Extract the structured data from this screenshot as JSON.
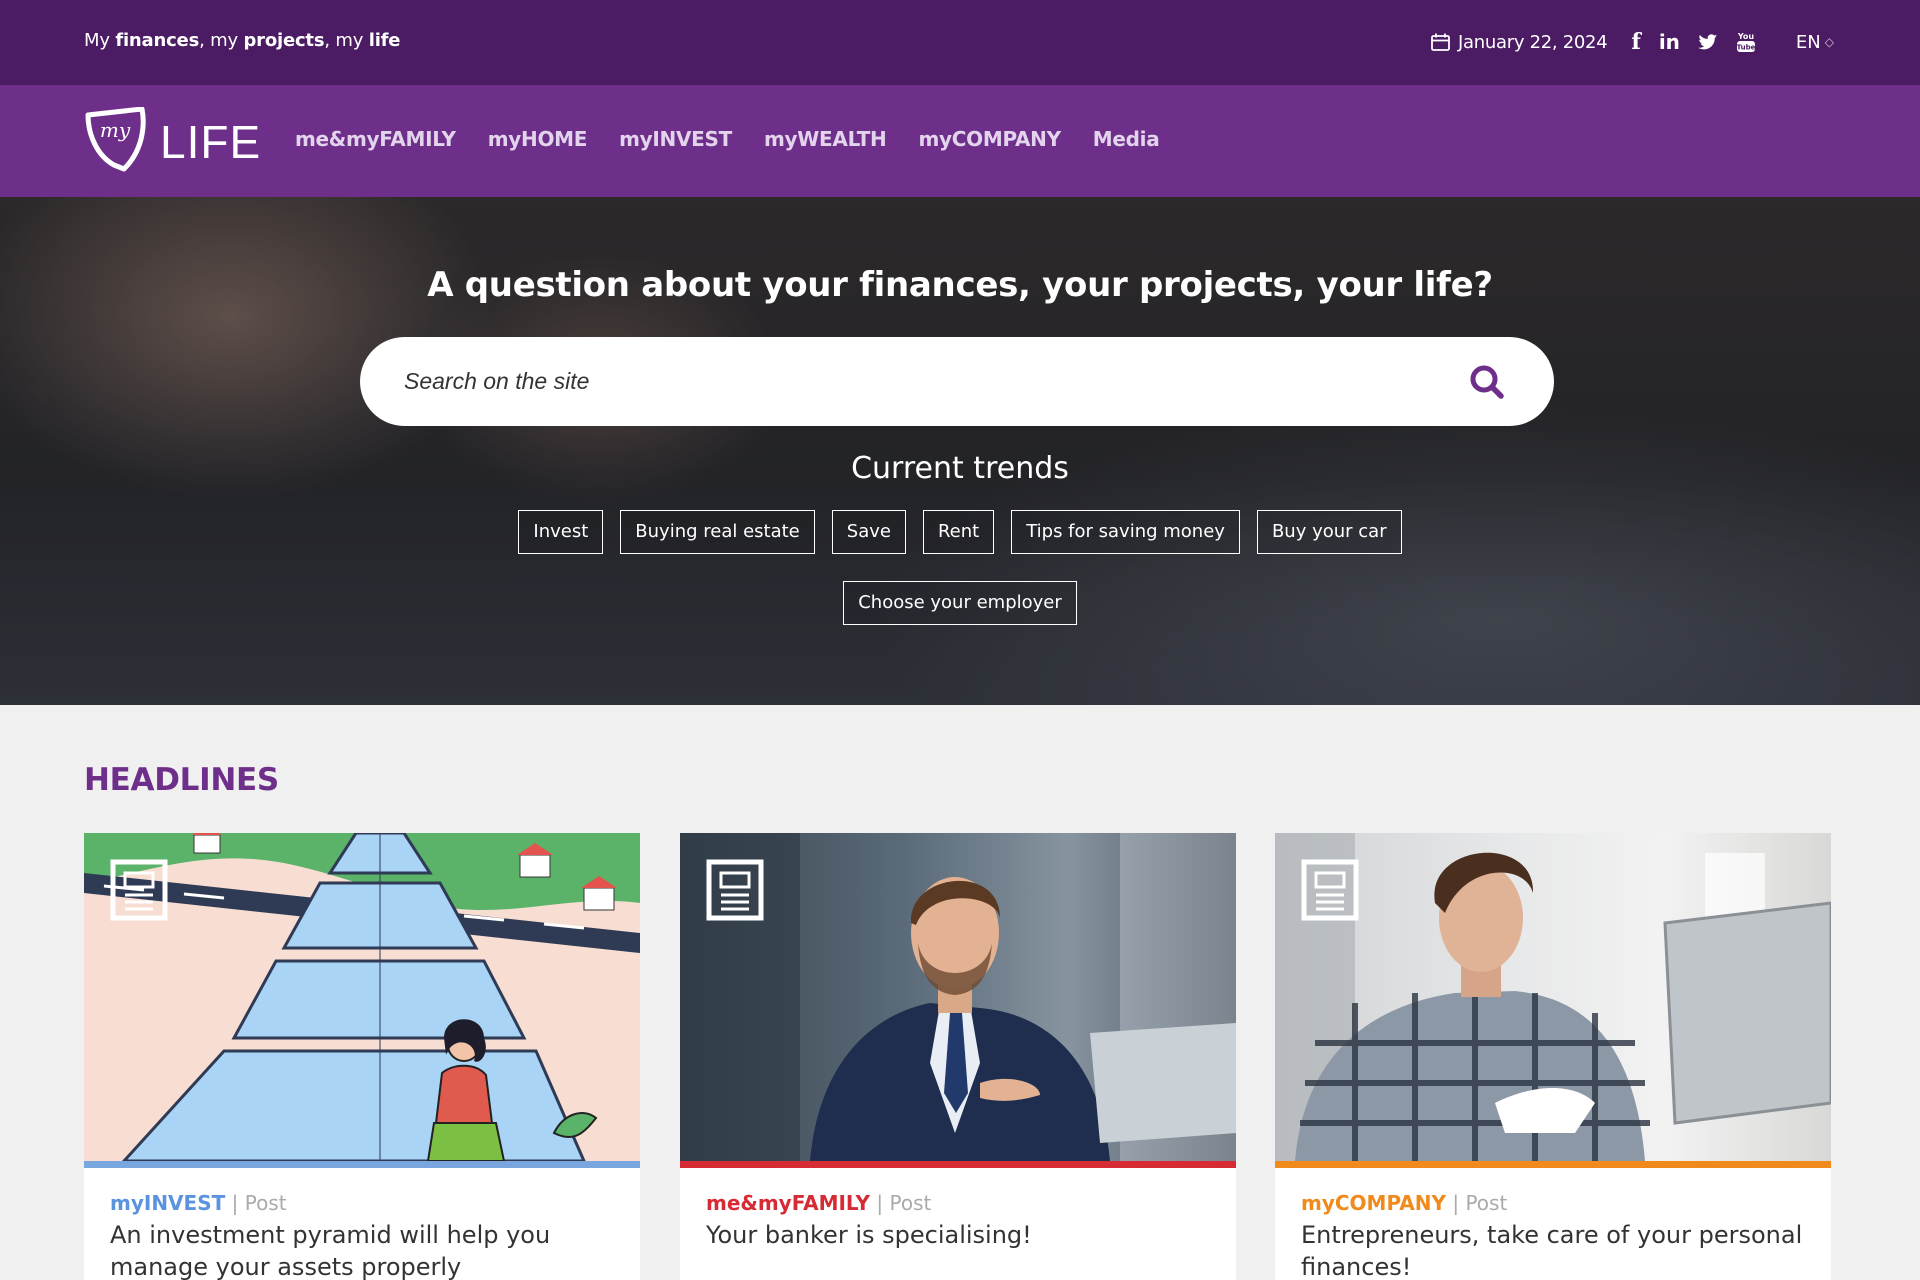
{
  "topbar": {
    "tagline": {
      "t1": "My ",
      "b1": "finances",
      "t2": ", my ",
      "b2": "projects",
      "t3": ", my ",
      "b3": "life"
    },
    "date": "January 22, 2024",
    "social": [
      "facebook-icon",
      "linkedin-icon",
      "twitter-icon",
      "youtube-icon"
    ],
    "language": "EN"
  },
  "nav": {
    "logo_my": "my",
    "logo_text": "LIFE",
    "items": [
      {
        "label": "me&myFAMILY"
      },
      {
        "label": "myHOME"
      },
      {
        "label": "myINVEST"
      },
      {
        "label": "myWEALTH"
      },
      {
        "label": "myCOMPANY"
      },
      {
        "label": "Media"
      }
    ]
  },
  "hero": {
    "title": "A question about your finances, your projects, your life?",
    "search_placeholder": "Search on the site",
    "trends_title": "Current trends",
    "trends": [
      "Invest",
      "Buying real estate",
      "Save",
      "Rent",
      "Tips for saving money",
      "Buy your car"
    ],
    "trends_row2": [
      "Choose your employer"
    ]
  },
  "headlines": {
    "title": "HEADLINES",
    "cards": [
      {
        "category": "myINVEST",
        "type": "Post",
        "title": "An investment pyramid will help you manage your assets properly",
        "color": "#7aa6e0"
      },
      {
        "category": "me&myFAMILY",
        "type": "Post",
        "title": "Your banker is specialising!",
        "color": "#d62b35"
      },
      {
        "category": "myCOMPANY",
        "type": "Post",
        "title": "Entrepreneurs, take care of your personal finances!",
        "color": "#f08a1c"
      }
    ]
  },
  "colors": {
    "topbar": "#4b1c63",
    "nav": "#6e2f8b",
    "accent": "#6e2f8b"
  }
}
